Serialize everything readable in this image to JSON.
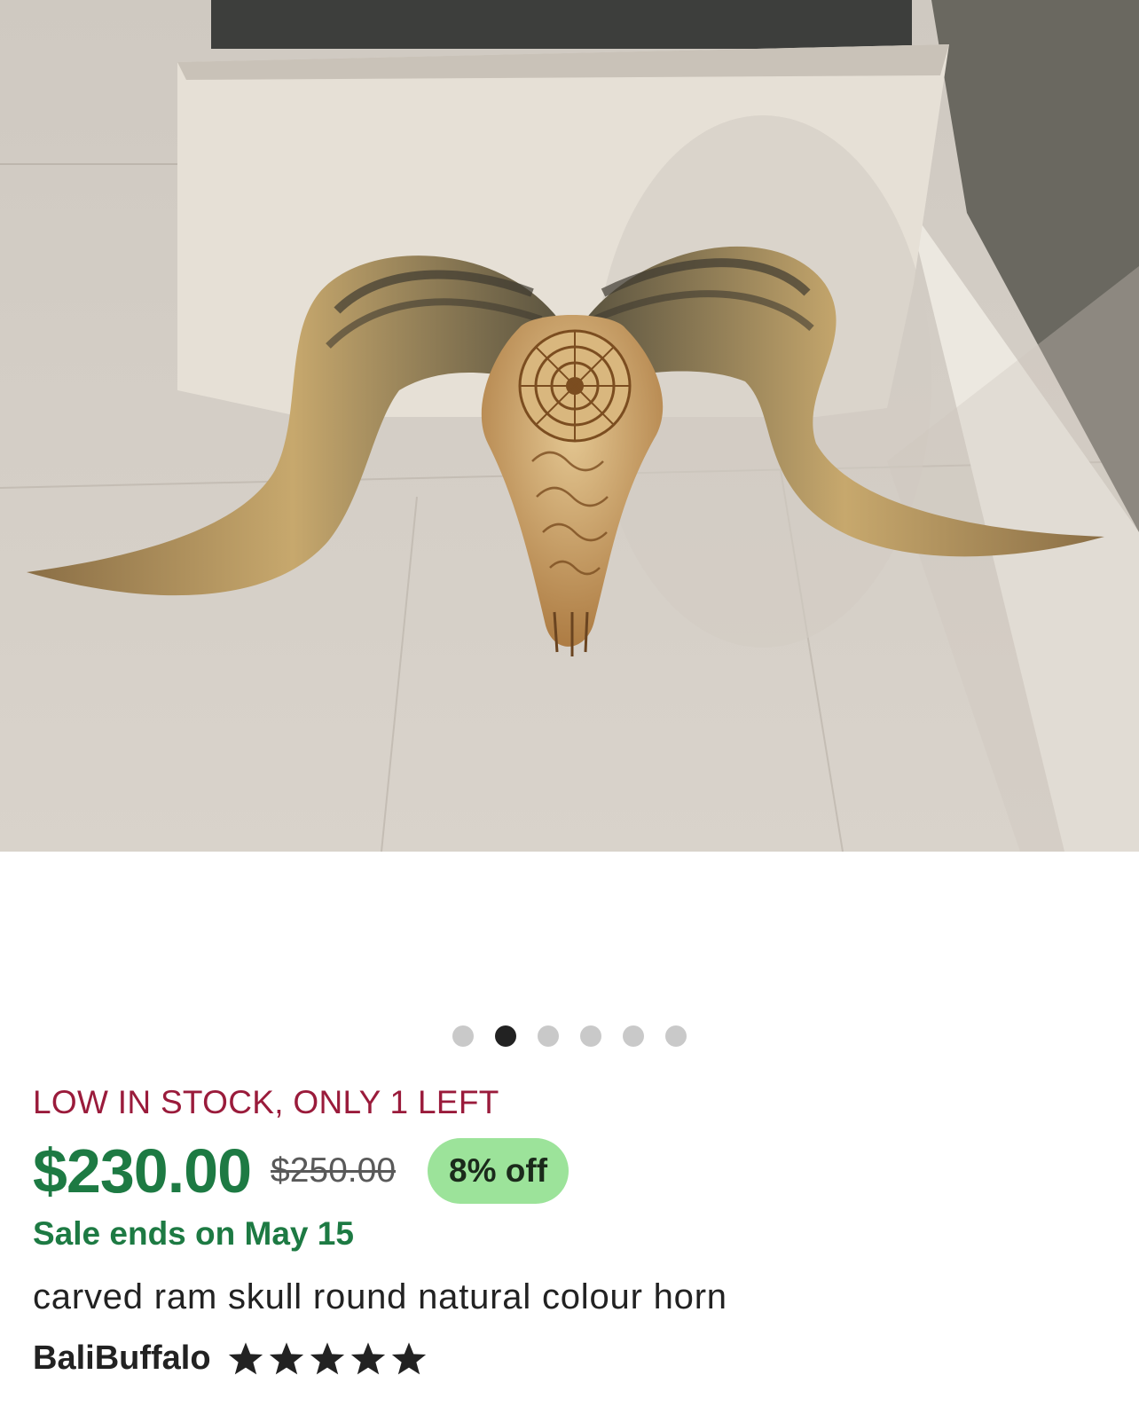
{
  "gallery": {
    "image_alt": "carved ram skull with natural colour horns",
    "dot_count": 6,
    "active_index": 1
  },
  "listing": {
    "stock_text": "LOW IN STOCK, ONLY 1 LEFT",
    "price": "$230.00",
    "original_price": "$250.00",
    "discount": "8% off",
    "sale_text": "Sale ends on May 15",
    "title": "carved ram skull round natural colour horn",
    "seller": "BaliBuffalo",
    "rating": 5
  },
  "colors": {
    "stock": "#9a1b3b",
    "price": "#1d7a43",
    "badge_bg": "#9ce39a",
    "star": "#222222"
  }
}
